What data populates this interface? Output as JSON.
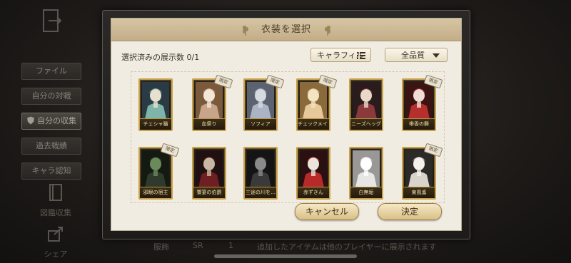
{
  "background": {
    "side_menu": [
      {
        "label": "ファイル",
        "active": false
      },
      {
        "label": "自分の対戦",
        "active": false
      },
      {
        "label": "自分の収集",
        "active": true
      },
      {
        "label": "過去戦績",
        "active": false
      },
      {
        "label": "キャラ認知",
        "active": false
      }
    ],
    "album_label": "図鑑収集",
    "share_label": "シェア",
    "bottom_left": "服飾",
    "bottom_grade": "SR",
    "bottom_count": "1",
    "bottom_note": "追加したアイテムは他のプレイヤーに展示されます"
  },
  "dialog": {
    "title": "衣装を選択",
    "selected_count": "選択済みの展示数 0/1",
    "filter_label": "キャラフィル",
    "grade_label": "全品質",
    "cancel_label": "キャンセル",
    "confirm_label": "決定"
  },
  "costume_badge": "限定",
  "costumes": [
    {
      "name": "チェシャ猫",
      "limited": false,
      "palette": [
        "#7fb5a8",
        "#e7e0cf",
        "#2b3b45"
      ]
    },
    {
      "name": "血祭り",
      "limited": true,
      "palette": [
        "#c7a48a",
        "#f2e6d6",
        "#7b5a3c"
      ]
    },
    {
      "name": "ソフィア",
      "limited": true,
      "palette": [
        "#aab4c4",
        "#d6dbe2",
        "#5b6270"
      ]
    },
    {
      "name": "チェックメイト",
      "limited": true,
      "palette": [
        "#e6c89a",
        "#f3e4c2",
        "#8a6a3a"
      ]
    },
    {
      "name": "ニーズヘッグ",
      "limited": false,
      "palette": [
        "#8a3a3a",
        "#ead9c8",
        "#2a1c1c"
      ]
    },
    {
      "name": "帯香の舞",
      "limited": true,
      "palette": [
        "#b5302c",
        "#f1ddd3",
        "#3a1412"
      ]
    },
    {
      "name": "邪眼の宿主",
      "limited": true,
      "palette": [
        "#2f3a2c",
        "#6b8a5a",
        "#141a12"
      ]
    },
    {
      "name": "饗宴の伯爵",
      "limited": false,
      "palette": [
        "#6e1f22",
        "#c9b7a4",
        "#201012"
      ]
    },
    {
      "name": "三途の川を…",
      "limited": false,
      "palette": [
        "#3a3a3a",
        "#8a8a8a",
        "#141414"
      ]
    },
    {
      "name": "赤ずきん",
      "limited": false,
      "palette": [
        "#b82a2a",
        "#ece4dc",
        "#2a1010"
      ]
    },
    {
      "name": "白無垢",
      "limited": false,
      "palette": [
        "#e8e6e4",
        "#ffffff",
        "#9a9896"
      ]
    },
    {
      "name": "東風遙",
      "limited": true,
      "palette": [
        "#d8d4cc",
        "#f4f1ea",
        "#2c2a27"
      ]
    }
  ]
}
